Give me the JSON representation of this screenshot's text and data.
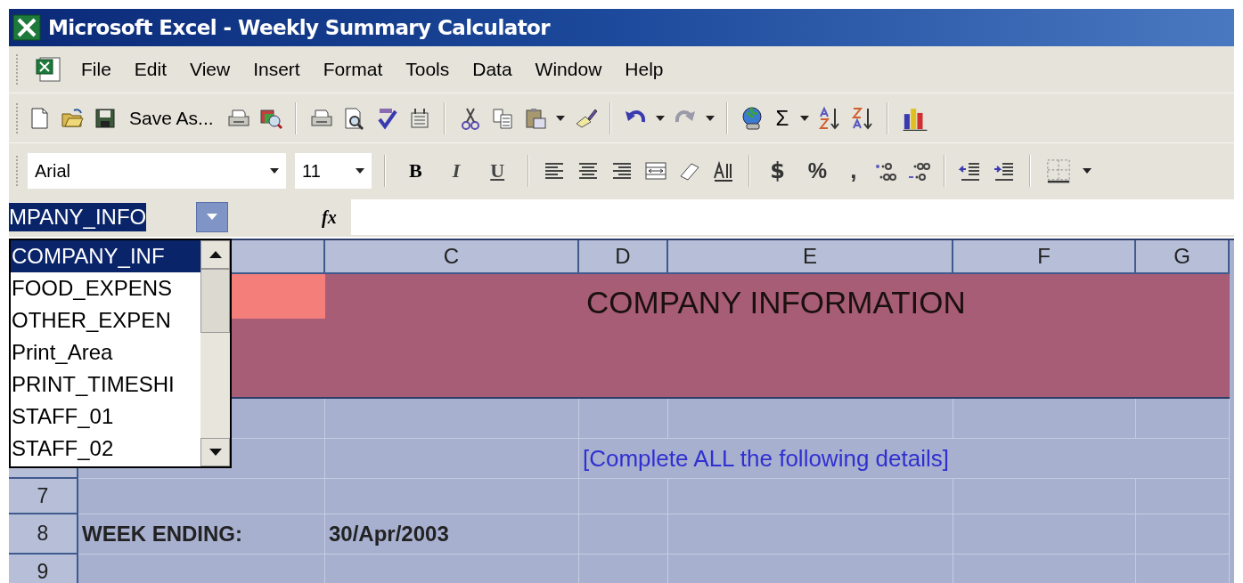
{
  "window": {
    "title": "Microsoft Excel - Weekly Summary Calculator"
  },
  "menu": [
    {
      "label": "File"
    },
    {
      "label": "Edit"
    },
    {
      "label": "View"
    },
    {
      "label": "Insert"
    },
    {
      "label": "Format"
    },
    {
      "label": "Tools"
    },
    {
      "label": "Data"
    },
    {
      "label": "Window"
    },
    {
      "label": "Help"
    }
  ],
  "standard_toolbar": {
    "save_as": {
      "label": "Save As..."
    },
    "autosum": "Σ"
  },
  "formatting_toolbar": {
    "font": "Arial",
    "font_size": "11",
    "bold": "B",
    "italic": "I",
    "underline": "U",
    "currency": "$",
    "percent": "%",
    "comma": ","
  },
  "formula_bar": {
    "name_box": {
      "value": "MPANY_INFO",
      "selected": true
    },
    "fx": "fx"
  },
  "name_list": [
    {
      "label": "COMPANY_INF",
      "selected": true
    },
    {
      "label": "FOOD_EXPENS",
      "selected": false
    },
    {
      "label": "OTHER_EXPEN",
      "selected": false
    },
    {
      "label": "Print_Area",
      "selected": false
    },
    {
      "label": "PRINT_TIMESHI",
      "selected": false
    },
    {
      "label": "STAFF_01",
      "selected": false
    },
    {
      "label": "STAFF_02",
      "selected": false
    }
  ],
  "columns": [
    "C",
    "D",
    "E",
    "F",
    "G"
  ],
  "row_headers": [
    "7",
    "8",
    "9"
  ],
  "cells": {
    "banner": "COMPANY INFORMATION",
    "instruction": "[Complete ALL the following details]",
    "week_label": "WEEK ENDING:",
    "week_value": "30/Apr/2003"
  }
}
